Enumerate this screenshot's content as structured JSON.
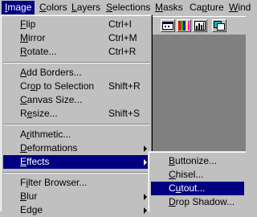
{
  "menubar": {
    "items": [
      {
        "label": "Image",
        "mnemonic": "I",
        "active": true
      },
      {
        "label": "Colors",
        "mnemonic": "C",
        "active": false
      },
      {
        "label": "Layers",
        "mnemonic": "L",
        "active": false
      },
      {
        "label": "Selections",
        "mnemonic": "S",
        "active": false
      },
      {
        "label": "Masks",
        "mnemonic": "M",
        "active": false
      },
      {
        "label": "Capture",
        "mnemonic": "p",
        "active": false
      },
      {
        "label": "Wind",
        "mnemonic": "W",
        "active": false
      }
    ]
  },
  "image_menu": {
    "flip": {
      "label": "Flip",
      "mnemonic": "F",
      "shortcut": "Ctrl+I"
    },
    "mirror": {
      "label": "Mirror",
      "mnemonic": "M",
      "shortcut": "Ctrl+M"
    },
    "rotate": {
      "label": "Rotate...",
      "mnemonic": "R",
      "shortcut": "Ctrl+R"
    },
    "add_borders": {
      "label": "Add Borders...",
      "mnemonic": "A"
    },
    "crop_to_selection": {
      "label": "Crop to Selection",
      "mnemonic": "o",
      "shortcut": "Shift+R"
    },
    "canvas_size": {
      "label": "Canvas Size...",
      "mnemonic": "C"
    },
    "resize": {
      "label": "Resize...",
      "mnemonic": "e",
      "shortcut": "Shift+S"
    },
    "arithmetic": {
      "label": "Arithmetic...",
      "mnemonic": "r"
    },
    "deformations": {
      "label": "Deformations",
      "mnemonic": "D"
    },
    "effects": {
      "label": "Effects",
      "mnemonic": "E"
    },
    "filter_browser": {
      "label": "Filter Browser...",
      "mnemonic": "i"
    },
    "blur": {
      "label": "Blur",
      "mnemonic": "B"
    },
    "edge": {
      "label": "Edge",
      "mnemonic": "g"
    }
  },
  "effects_submenu": {
    "buttonize": {
      "label": "Buttonize...",
      "mnemonic": "B"
    },
    "chisel": {
      "label": "Chisel...",
      "mnemonic": "C"
    },
    "cutout": {
      "label": "Cutout...",
      "mnemonic": "u"
    },
    "drop_shadow": {
      "label": "Drop Shadow...",
      "mnemonic": "D"
    }
  },
  "toolbar": {
    "icons": [
      "image-window-icon",
      "color-palette-icon",
      "histogram-icon",
      "layers-icon"
    ]
  },
  "colors": {
    "face": "#c0c0c0",
    "highlight": "#000080",
    "workspace": "#808080"
  }
}
